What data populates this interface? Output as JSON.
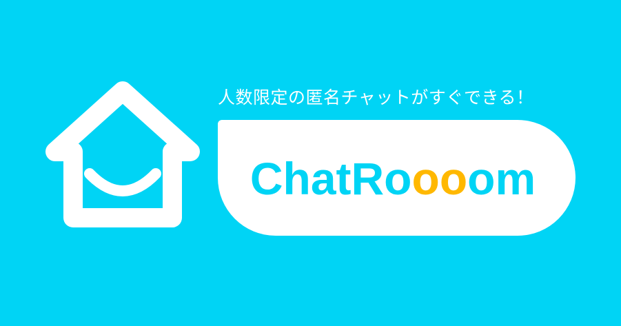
{
  "banner": {
    "background_color": "#00D4F5",
    "tagline": "人数限定の匿名チャットがすぐできる！",
    "logo_icon": "house-smile-icon",
    "wordmark": {
      "part_start": "ChatRo",
      "part_highlight": "oo",
      "part_end": "om",
      "accent_color": "#00D4F5",
      "highlight_color": "#FFB800"
    }
  }
}
